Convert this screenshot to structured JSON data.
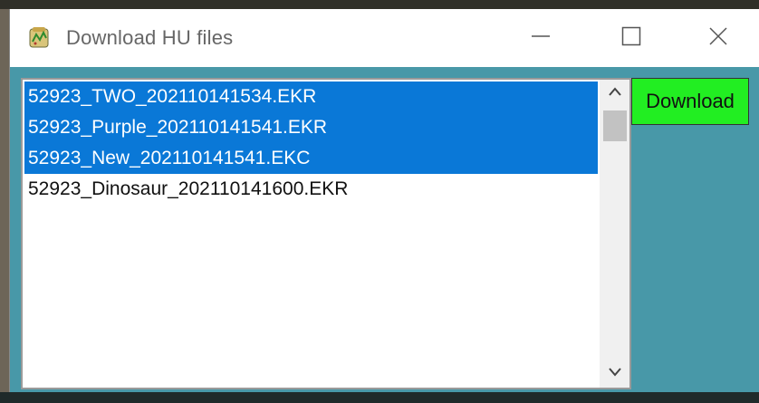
{
  "window": {
    "title": "Download HU files",
    "icon": "app-icon"
  },
  "controls": {
    "minimize": "minimize-icon",
    "maximize": "maximize-icon",
    "close": "close-icon"
  },
  "files": {
    "items": [
      {
        "label": "52923_TWO_202110141534.EKR",
        "selected": true
      },
      {
        "label": "52923_Purple_202110141541.EKR",
        "selected": true
      },
      {
        "label": "52923_New_202110141541.EKC",
        "selected": true
      },
      {
        "label": "52923_Dinosaur_202110141600.EKR",
        "selected": false
      }
    ]
  },
  "actions": {
    "download_label": "Download"
  },
  "colors": {
    "selection": "#0a78d7",
    "client_background": "#4898a8",
    "download_button": "#22ee22"
  }
}
